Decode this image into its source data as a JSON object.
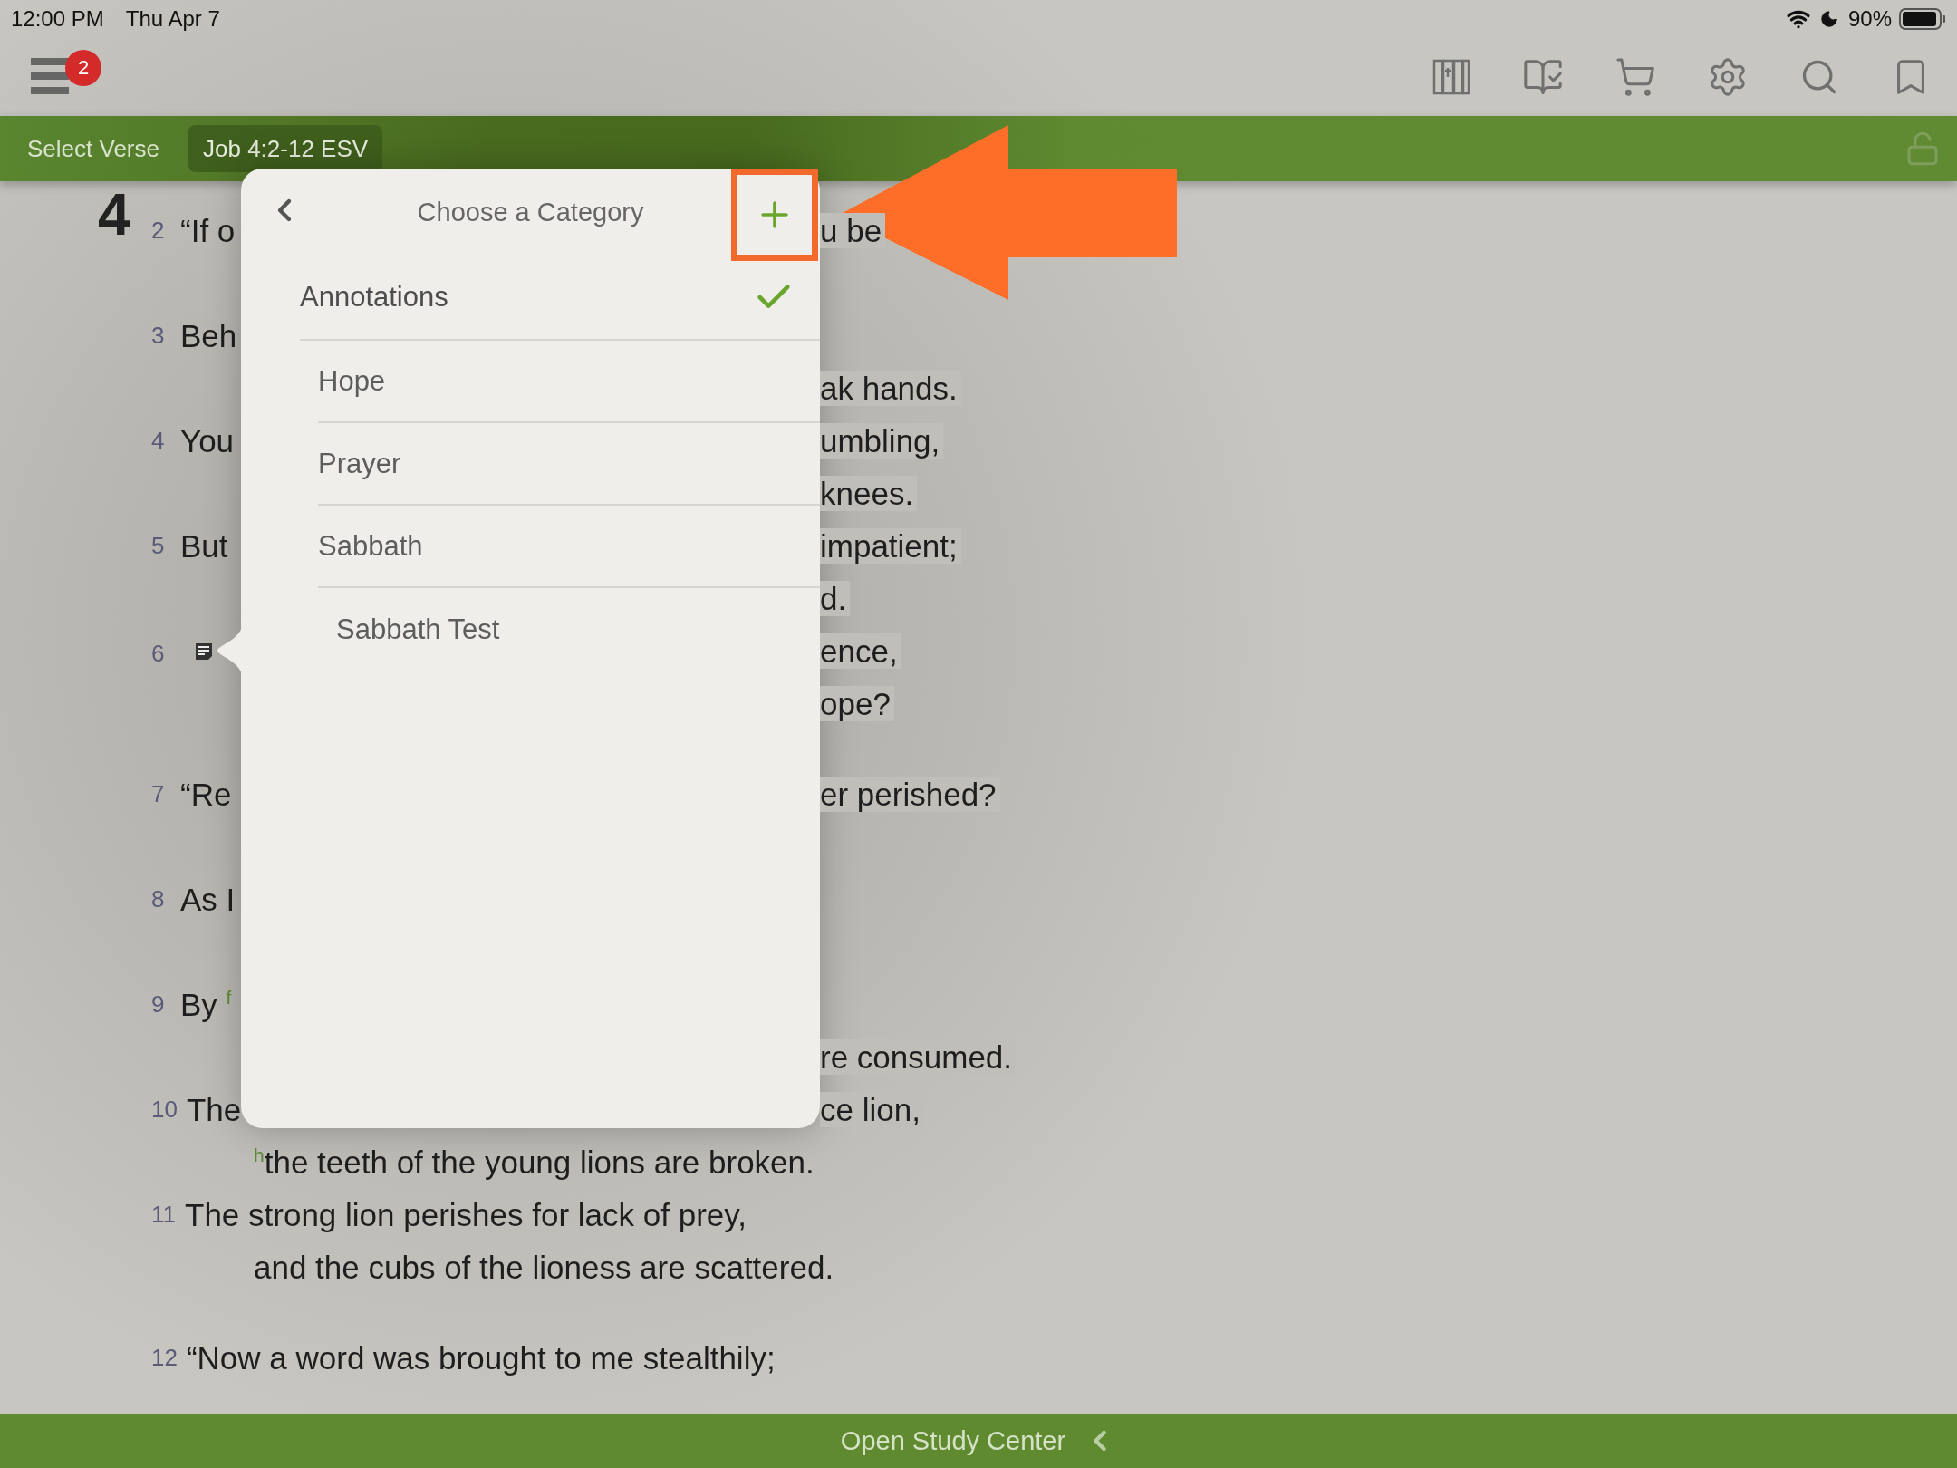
{
  "status_bar": {
    "time": "12:00 PM",
    "date": "Thu Apr 7",
    "battery": "90%"
  },
  "toolbar": {
    "badge": "2"
  },
  "verse_bar": {
    "label": "Select Verse",
    "reference": "Job 4:2-12 ESV"
  },
  "passage": {
    "chapter": "4",
    "stanzas": [
      {
        "verses": [
          {
            "lines": [
              {
                "number": "2",
                "text": "“If o",
                "right": "u be"
              }
            ]
          },
          {
            "lines": [
              {
                "number": "3",
                "text": "Beh"
              },
              {
                "right": "ak hands."
              }
            ]
          },
          {
            "lines": [
              {
                "number": "4",
                "text": "You",
                "right": "umbling,"
              },
              {
                "right": "knees."
              }
            ]
          },
          {
            "lines": [
              {
                "number": "5",
                "text": "But",
                "right": "impatient;"
              },
              {
                "right": "d."
              }
            ]
          },
          {
            "lines": [
              {
                "number": "6",
                "note": true,
                "right": "ence,"
              },
              {
                "right": "ope?"
              }
            ]
          }
        ]
      },
      {
        "verses": [
          {
            "lines": [
              {
                "number": "7",
                "text": "“Re",
                "right": "er perished?"
              }
            ]
          },
          {
            "lines": [
              {
                "number": "8",
                "text": "As I"
              }
            ]
          },
          {
            "lines": [
              {
                "number": "9",
                "text": "By $^{f}$"
              },
              {
                "right": "re consumed."
              }
            ]
          },
          {
            "lines": [
              {
                "number": "10",
                "text": "The",
                "right": "ce lion,"
              },
              {
                "indent": true,
                "text": "$^{h}$the teeth of the young lions are broken."
              }
            ]
          },
          {
            "lines": [
              {
                "number": "11",
                "text": "The strong lion perishes for lack of prey,"
              },
              {
                "indent": true,
                "text": "and the cubs of the lioness are scattered."
              }
            ]
          }
        ]
      },
      {
        "verses": [
          {
            "lines": [
              {
                "number": "12",
                "text": "“Now a word was brought to me stealthily;"
              }
            ]
          }
        ]
      }
    ]
  },
  "popover": {
    "title": "Choose a Category",
    "categories": [
      {
        "label": "Annotations",
        "selected": true,
        "children": [
          {
            "label": "Hope",
            "selected": false
          },
          {
            "label": "Prayer",
            "selected": false
          },
          {
            "label": "Sabbath",
            "selected": false,
            "children": [
              {
                "label": "Sabbath Test",
                "selected": false
              }
            ]
          }
        ]
      }
    ]
  },
  "bottom_bar": {
    "label": "Open Study Center"
  }
}
